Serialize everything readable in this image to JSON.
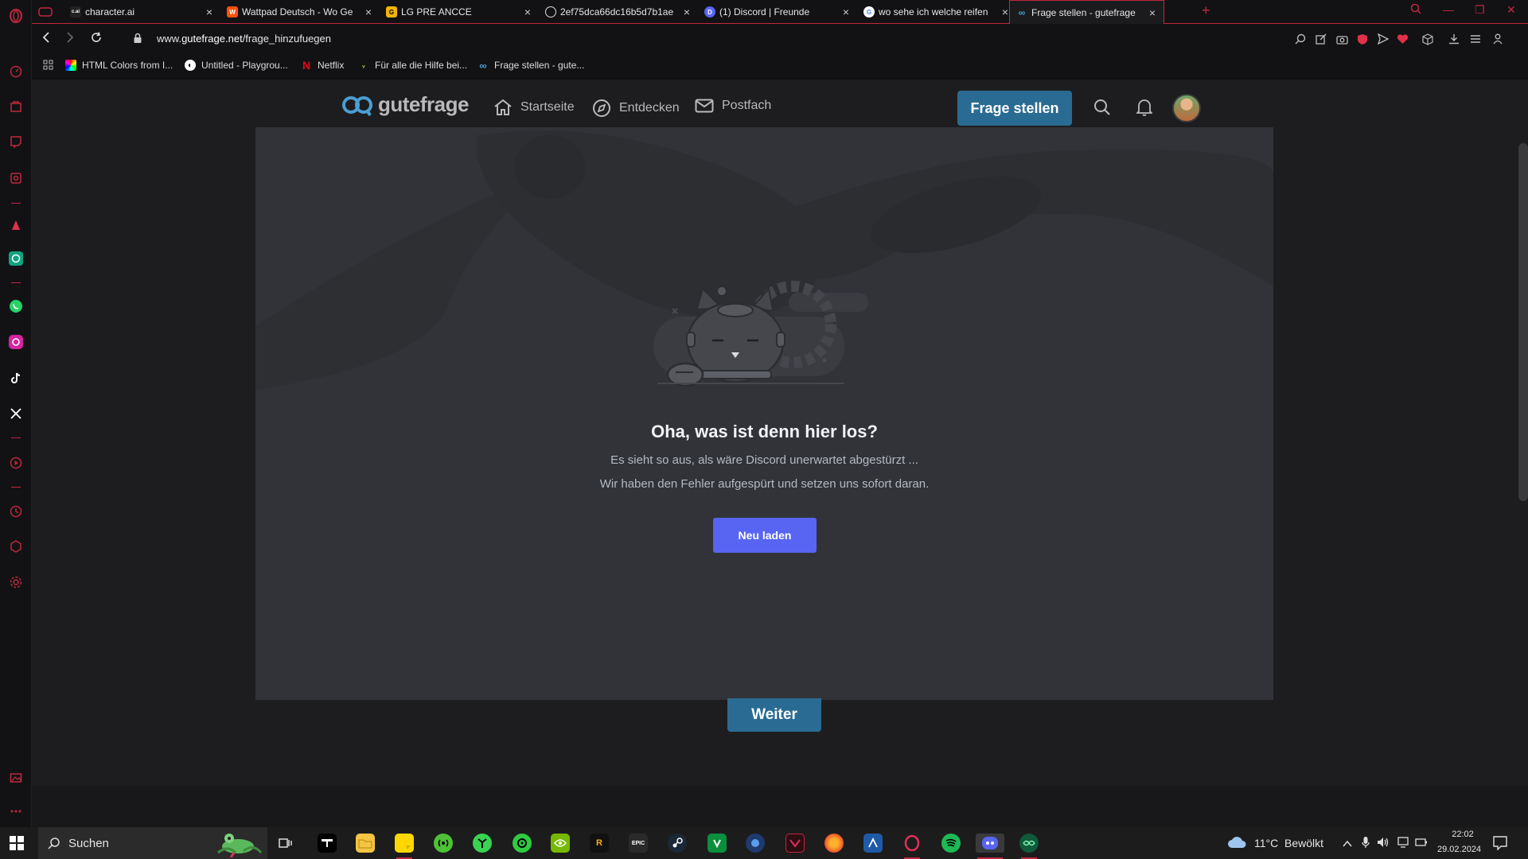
{
  "browser": {
    "tabs": [
      {
        "label": "character.ai",
        "favicon_text": "c.ai",
        "favicon_color": "#222222",
        "active": false
      },
      {
        "label": "Wattpad Deutsch - Wo Ge",
        "favicon_text": "W",
        "favicon_color": "#ff500a",
        "active": false
      },
      {
        "label": "LG PRE ANCCE",
        "favicon_text": "G",
        "favicon_color": "#f4b400",
        "active": false
      },
      {
        "label": "2ef75dca66dc16b5d7b1ae",
        "favicon_text": "",
        "favicon_color": "#444444",
        "active": false
      },
      {
        "label": "(1) Discord | Freunde",
        "favicon_text": "D",
        "favicon_color": "#5865f2",
        "active": false
      },
      {
        "label": "wo sehe ich welche reifen",
        "favicon_text": "G",
        "favicon_color": "#4285f4",
        "active": false
      },
      {
        "label": "Frage stellen - gutefrage",
        "favicon_text": "∞",
        "favicon_color": "#2a6b93",
        "active": true
      }
    ],
    "url_prefix": "www.",
    "url_domain": "gutefrage.net",
    "url_path": "/frage_hinzufuegen",
    "bookmarks": [
      {
        "label": "HTML Colors from I..."
      },
      {
        "label": "Untitled - Playgrou..."
      },
      {
        "label": "Netflix"
      },
      {
        "label": "Für alle die Hilfe bei..."
      },
      {
        "label": "Frage stellen - gute..."
      }
    ],
    "accent_color": "#c0283f"
  },
  "gutefrage": {
    "logo": "gutefrage",
    "nav": [
      {
        "label": "Startseite",
        "icon": "home-icon"
      },
      {
        "label": "Entdecken",
        "icon": "compass-icon"
      },
      {
        "label": "Postfach",
        "icon": "mail-icon"
      }
    ],
    "ask_button": "Frage stellen",
    "next_button": "Weiter",
    "brand_color": "#2a6b93"
  },
  "crash": {
    "title": "Oha, was ist denn hier los?",
    "line1": "Es sieht so aus, als wäre Discord unerwartet abgestürzt ...",
    "line2": "Wir haben den Fehler aufgespürt und setzen uns sofort daran.",
    "reload_button": "Neu laden",
    "button_color": "#5865f2"
  },
  "taskbar": {
    "search_placeholder": "Suchen",
    "weather_temp": "11°C",
    "weather_text": "Bewölkt",
    "time": "22:02",
    "date": "29.02.2024"
  }
}
